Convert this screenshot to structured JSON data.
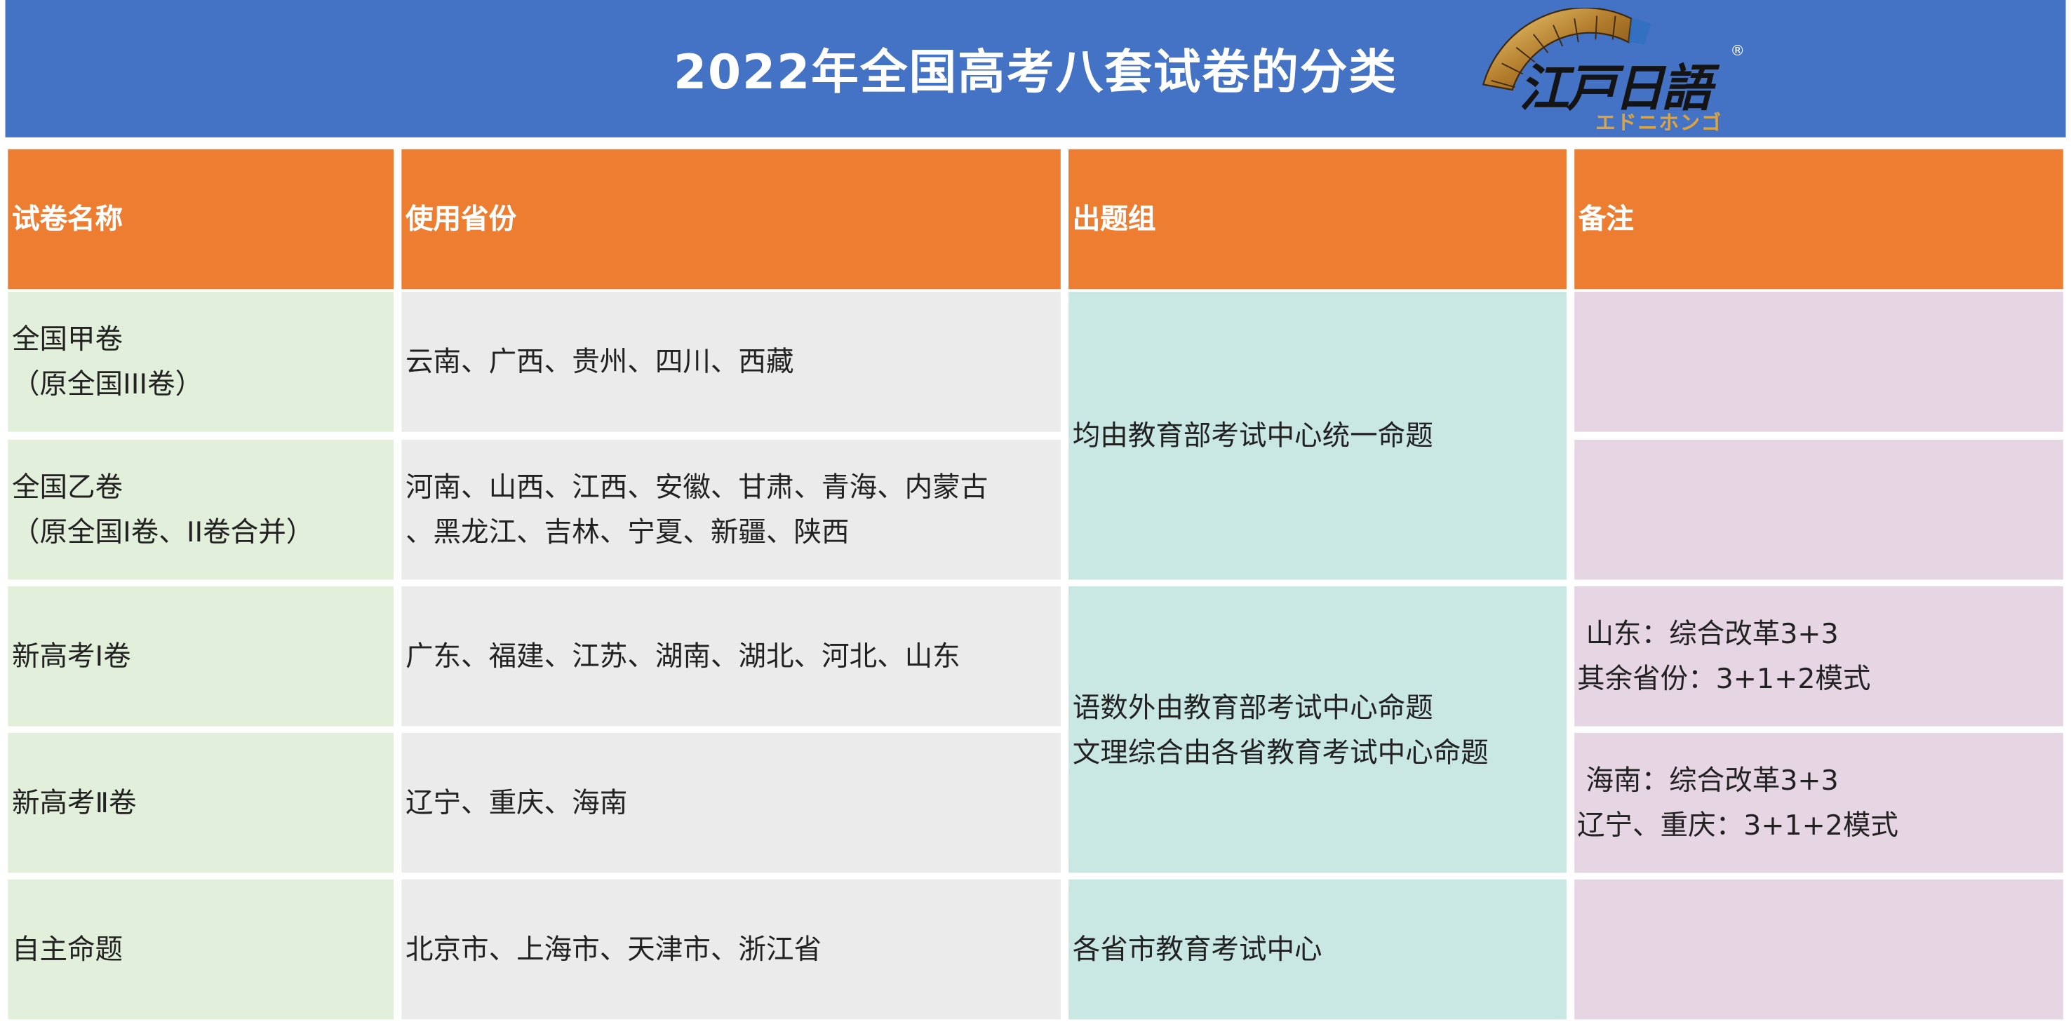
{
  "title": "2022年全国高考八套试卷的分类",
  "logo": {
    "text": "江戸日語",
    "subtitle": "エドニホンゴ",
    "mark": "®"
  },
  "table": {
    "headers": [
      "试卷名称",
      "使用省份",
      "出题组",
      "备注"
    ],
    "rows": [
      {
        "name": [
          "全国甲卷",
          "（原全国III卷）"
        ],
        "provinces": [
          "云南、广西、贵州、四川、西藏"
        ],
        "remark": []
      },
      {
        "name": [
          "全国乙卷",
          "（原全国I卷、II卷合并）"
        ],
        "provinces": [
          "河南、山西、江西、安徽、甘肃、青海、内蒙古",
          "、黑龙江、吉林、宁夏、新疆、陕西"
        ],
        "remark": []
      },
      {
        "name": [
          "新高考Ⅰ卷"
        ],
        "provinces": [
          "广东、福建、江苏、湖南、湖北、河北、山东"
        ],
        "remark": [
          " 山东：综合改革3+3",
          "其余省份：3+1+2模式"
        ]
      },
      {
        "name": [
          "新高考Ⅱ卷"
        ],
        "provinces": [
          "辽宁、重庆、海南"
        ],
        "remark": [
          " 海南：综合改革3+3",
          "辽宁、重庆：3+1+2模式"
        ]
      },
      {
        "name": [
          "自主命题"
        ],
        "provinces": [
          "北京市、上海市、天津市、浙江省"
        ],
        "remark": []
      }
    ],
    "groups": [
      [
        "均由教育部考试中心统一命题"
      ],
      [
        "语数外由教育部考试中心命题",
        "文理综合由各省教育考试中心命题"
      ],
      [
        "各省市教育考试中心"
      ]
    ]
  },
  "colors": {
    "banner": "#4472c4",
    "header": "#ed7d31",
    "col_name": "#e2efda",
    "col_provinces": "#ebebeb",
    "col_group": "#c9e8e3",
    "col_remark": "#e6d5e3"
  }
}
